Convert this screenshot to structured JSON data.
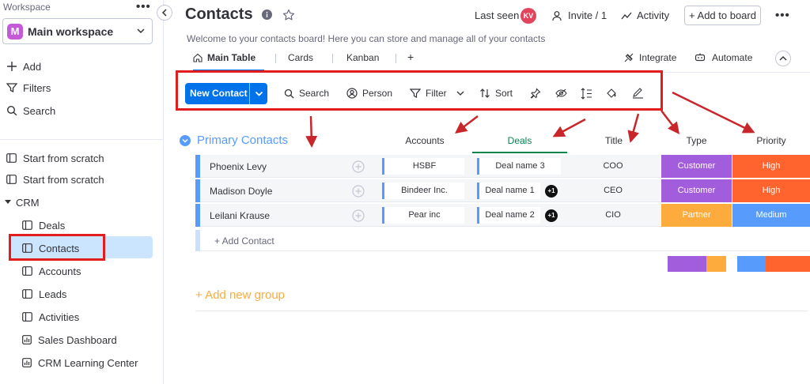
{
  "sidebar": {
    "workspace_label": "Workspace",
    "menu_dots": "•••",
    "workspace_initial": "M",
    "workspace_name": "Main workspace",
    "actions": [
      {
        "label": "Add",
        "icon": "plus-icon"
      },
      {
        "label": "Filters",
        "icon": "filter-icon"
      },
      {
        "label": "Search",
        "icon": "search-icon"
      }
    ],
    "items": [
      {
        "label": "Start from scratch",
        "icon": "board-icon"
      },
      {
        "label": "Start from scratch",
        "icon": "board-icon"
      },
      {
        "label": "CRM",
        "icon": "caret-down-icon"
      },
      {
        "label": "Deals",
        "icon": "board-icon"
      },
      {
        "label": "Contacts",
        "icon": "board-icon",
        "selected": true
      },
      {
        "label": "Accounts",
        "icon": "board-icon"
      },
      {
        "label": "Leads",
        "icon": "board-icon"
      },
      {
        "label": "Activities",
        "icon": "board-icon"
      },
      {
        "label": "Sales Dashboard",
        "icon": "dashboard-icon"
      },
      {
        "label": "CRM Learning Center",
        "icon": "dashboard-icon"
      }
    ]
  },
  "header": {
    "title": "Contacts",
    "last_seen_label": "Last seen",
    "avatar_initials": "KV",
    "invite_label": "Invite / 1",
    "activity_label": "Activity",
    "add_to_board_label": "+ Add to board",
    "more_dots": "•••",
    "description": "Welcome to your contacts board! Here you can store and manage all of your contacts"
  },
  "views": {
    "tabs": [
      {
        "label": "Main Table",
        "active": true
      },
      {
        "label": "Cards"
      },
      {
        "label": "Kanban"
      },
      {
        "label": "+"
      }
    ],
    "integrate_label": "Integrate",
    "automate_label": "Automate"
  },
  "toolbar": {
    "new_item_label": "New Contact",
    "search_label": "Search",
    "person_label": "Person",
    "filter_label": "Filter",
    "sort_label": "Sort",
    "icons": [
      "pin-icon",
      "hide-icon",
      "row-height-icon",
      "color-icon",
      "edit-icon"
    ]
  },
  "group": {
    "title": "Primary Contacts",
    "color": "#579bfc",
    "columns": [
      "Accounts",
      "Deals",
      "Title",
      "Type",
      "Priority"
    ],
    "rows": [
      {
        "name": "Phoenix Levy",
        "account": "HSBF",
        "deal": "Deal name 3",
        "deal_extra": "",
        "title": "COO",
        "type": "Customer",
        "type_color": "#a25ddc",
        "priority": "High",
        "priority_color": "#ff642e"
      },
      {
        "name": "Madison Doyle",
        "account": "Bindeer Inc.",
        "deal": "Deal name 1",
        "deal_extra": "+1",
        "title": "CEO",
        "type": "Customer",
        "type_color": "#a25ddc",
        "priority": "High",
        "priority_color": "#ff642e"
      },
      {
        "name": "Leilani Krause",
        "account": "Pear inc",
        "deal": "Deal name 2",
        "deal_extra": "+1",
        "title": "CIO",
        "type": "Partner",
        "type_color": "#fdab3d",
        "priority": "Medium",
        "priority_color": "#579bfc"
      }
    ],
    "add_item_label": "+ Add Contact"
  },
  "add_group_label": "+ Add new group",
  "colors": {
    "primary": "#0073ea",
    "annotation_red": "#e11d1d",
    "selected_bg": "#cce5ff",
    "add_group": "#fdab3d"
  }
}
